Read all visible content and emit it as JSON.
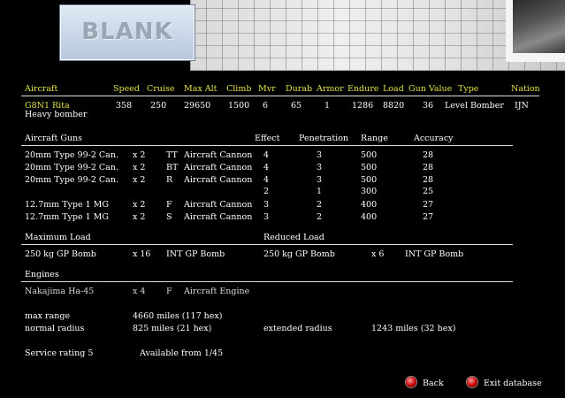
{
  "header": {
    "blank_label": "BLANK",
    "columns": [
      "Aircraft",
      "Speed",
      "Cruise",
      "Max Alt",
      "Climb",
      "Mvr",
      "Durab",
      "Armor",
      "Endure",
      "Load",
      "Gun Value",
      "Type",
      "Nation"
    ]
  },
  "aircraft": {
    "name": "G8N1 Rita",
    "role": "Heavy bomber",
    "speed": "358",
    "cruise": "250",
    "max_alt": "29650",
    "climb": "1500",
    "mvr": "6",
    "durab": "65",
    "armor": "1",
    "endure": "1286",
    "load": "8820",
    "gun_value": "36",
    "type": "Level Bomber",
    "nation": "IJN"
  },
  "guns": {
    "headers": [
      "Aircraft Guns",
      "Effect",
      "Penetration",
      "Range",
      "Accuracy"
    ],
    "rows": [
      {
        "name": "20mm Type 99-2 Can.",
        "qty": "x 2",
        "pos": "TT",
        "kind": "Aircraft Cannon",
        "effect": "4",
        "pen": "3",
        "range": "500",
        "acc": "28"
      },
      {
        "name": "20mm Type 99-2 Can.",
        "qty": "x 2",
        "pos": "BT",
        "kind": "Aircraft Cannon",
        "effect": "4",
        "pen": "3",
        "range": "500",
        "acc": "28"
      },
      {
        "name": "20mm Type 99-2 Can.",
        "qty": "x 2",
        "pos": "R",
        "kind": "Aircraft Cannon",
        "effect": "4",
        "pen": "3",
        "range": "500",
        "acc": "28"
      },
      {
        "name": "",
        "qty": "",
        "pos": "",
        "kind": "",
        "effect": "2",
        "pen": "1",
        "range": "300",
        "acc": "25"
      },
      {
        "name": "12.7mm Type 1 MG",
        "qty": "x 2",
        "pos": "F",
        "kind": "Aircraft Cannon",
        "effect": "3",
        "pen": "2",
        "range": "400",
        "acc": "27"
      },
      {
        "name": "12.7mm Type 1 MG",
        "qty": "x 2",
        "pos": "S",
        "kind": "Aircraft Cannon",
        "effect": "3",
        "pen": "2",
        "range": "400",
        "acc": "27"
      }
    ]
  },
  "loads": {
    "max_label": "Maximum Load",
    "reduced_label": "Reduced Load",
    "max": {
      "name": "250 kg GP Bomb",
      "qty": "x 16",
      "type": "INT GP Bomb"
    },
    "reduced": {
      "name": "250 kg GP Bomb",
      "qty": "x 6",
      "type": "INT GP Bomb"
    }
  },
  "engines": {
    "label": "Engines",
    "name": "Nakajima Ha-45",
    "qty": "x 4",
    "pos": "F",
    "type": "Aircraft Engine"
  },
  "ranges": {
    "max_range_label": "max range",
    "max_range": "4660 miles (117 hex)",
    "normal_radius_label": "normal radius",
    "normal_radius": "825 miles (21 hex)",
    "extended_radius_label": "extended radius",
    "extended_radius": "1243 miles (32 hex)"
  },
  "service": {
    "rating": "Service rating  5",
    "available": "Available from  1/45"
  },
  "buttons": {
    "back": "Back",
    "exit": "Exit database"
  },
  "colors": {
    "header_text": "#e3e34a",
    "body_text": "#ffffff",
    "button": "#c40000"
  }
}
